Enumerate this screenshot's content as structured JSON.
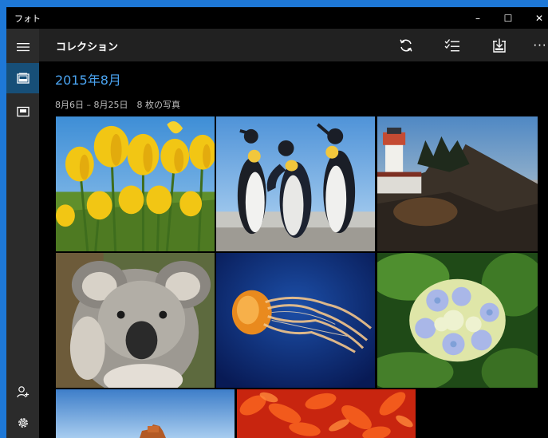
{
  "window": {
    "app_title": "フォト",
    "minimize_glyph": "–",
    "maximize_glyph": "☐",
    "close_glyph": "✕"
  },
  "nav": {
    "items": [
      {
        "id": "menu",
        "icon": "hamburger-icon"
      },
      {
        "id": "collection",
        "icon": "photo-collection-icon",
        "selected": true
      },
      {
        "id": "albums",
        "icon": "album-icon"
      },
      {
        "id": "account",
        "icon": "add-account-icon"
      },
      {
        "id": "settings",
        "icon": "gear-icon"
      }
    ]
  },
  "command_bar": {
    "title": "コレクション",
    "buttons": [
      {
        "id": "refresh",
        "icon": "refresh-icon"
      },
      {
        "id": "select",
        "icon": "select-list-icon"
      },
      {
        "id": "import",
        "icon": "import-icon"
      },
      {
        "id": "more",
        "icon": "more-icon",
        "label": "···"
      }
    ]
  },
  "collection": {
    "month_title": "2015年8月",
    "date_range": "8月6日 – 8月25日　8 枚の写真",
    "photos": [
      {
        "id": "tulips",
        "subject": "yellow tulips"
      },
      {
        "id": "penguins",
        "subject": "penguins"
      },
      {
        "id": "lighthouse",
        "subject": "lighthouse at sunset"
      },
      {
        "id": "koala",
        "subject": "koala"
      },
      {
        "id": "jellyfish",
        "subject": "jellyfish"
      },
      {
        "id": "hydrangea",
        "subject": "hydrangea"
      },
      {
        "id": "desert",
        "subject": "desert rock"
      },
      {
        "id": "chrysanthemum",
        "subject": "red chrysanthemum"
      }
    ]
  },
  "colors": {
    "window_border": "#1e78d7",
    "accent_text": "#4aa3f0",
    "nav_selected": "#174f78",
    "nav_background": "#2b2b2b",
    "command_bar": "#212121"
  }
}
